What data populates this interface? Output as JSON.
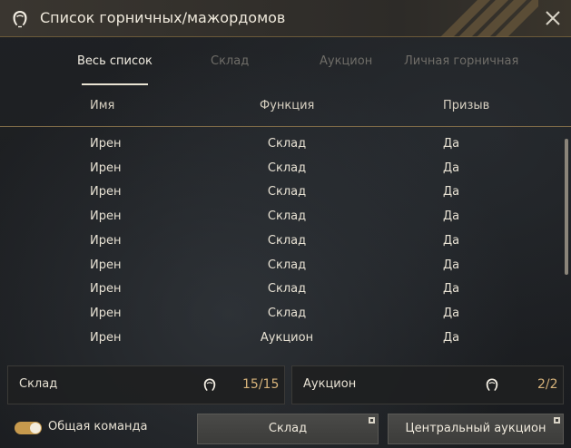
{
  "window": {
    "title": "Список горничных/мажордомов",
    "close_icon": "close-icon",
    "maid_icon": "maid-icon"
  },
  "tabs": [
    {
      "label": "Весь список",
      "active": true
    },
    {
      "label": "Склад",
      "active": false
    },
    {
      "label": "Аукцион",
      "active": false
    },
    {
      "label": "Личная горничная",
      "active": false
    }
  ],
  "table": {
    "headers": {
      "name": "Имя",
      "function": "Функция",
      "summon": "Призыв"
    },
    "rows": [
      {
        "name": "Ирен",
        "function": "Склад",
        "summon": "Да"
      },
      {
        "name": "Ирен",
        "function": "Склад",
        "summon": "Да"
      },
      {
        "name": "Ирен",
        "function": "Склад",
        "summon": "Да"
      },
      {
        "name": "Ирен",
        "function": "Склад",
        "summon": "Да"
      },
      {
        "name": "Ирен",
        "function": "Склад",
        "summon": "Да"
      },
      {
        "name": "Ирен",
        "function": "Склад",
        "summon": "Да"
      },
      {
        "name": "Ирен",
        "function": "Склад",
        "summon": "Да"
      },
      {
        "name": "Ирен",
        "function": "Склад",
        "summon": "Да"
      },
      {
        "name": "Ирен",
        "function": "Аукцион",
        "summon": "Да"
      }
    ]
  },
  "counters": {
    "warehouse": {
      "label": "Склад",
      "value": "15/15"
    },
    "auction": {
      "label": "Аукцион",
      "value": "2/2"
    }
  },
  "footer": {
    "toggle_label": "Общая команда",
    "toggle_on": true,
    "warehouse_button": "Склад",
    "auction_button": "Центральный аукцион"
  },
  "colors": {
    "accent": "#c79a4d",
    "counter_value": "#d6b27a",
    "divider": "#7d6a47"
  }
}
